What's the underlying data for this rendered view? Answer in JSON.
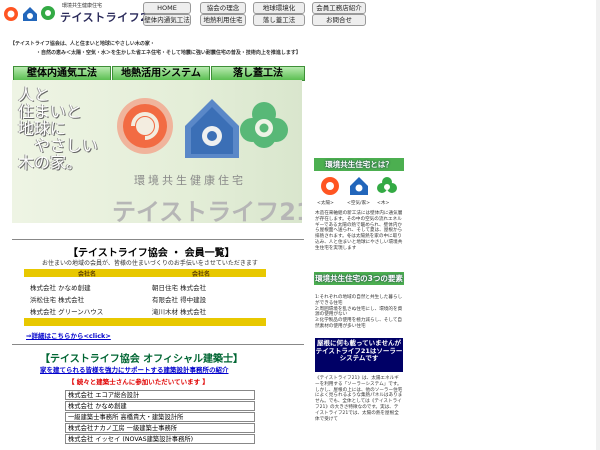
{
  "header": {
    "logo_subtitle": "環境共生健康住宅",
    "logo_title": "テイストライフ21"
  },
  "nav": {
    "row1": [
      "HOME",
      "協会の理念",
      "地球環境化",
      "会員工務店紹介"
    ],
    "row2": [
      "壁体内通気工法",
      "地熱利用住宅",
      "落し蓋工法",
      "お問合せ"
    ]
  },
  "intro": {
    "line1": "【テイストライフ協会は、人と住まいと地球にやさしい木の家・",
    "line2": "・自然の恵み＜太陽・空気・水＞を生かした省エネ住宅・そして地震に強い耐震住宅の普及・技術向上を推進します】"
  },
  "tabs": [
    "壁体内通気工法",
    "地熱活用システム",
    "落し蓋工法"
  ],
  "hero": {
    "lines": [
      "人と",
      "住まいと",
      "地球に",
      "やさしい",
      "木の家。"
    ],
    "subtitle": "環境共生健康住宅",
    "big": "テイストライフ21"
  },
  "members": {
    "title": "【テイストライフ協会 ・ 会員一覧】",
    "note": "お住まいの地域の会員が、皆様の住まいづくりのお手伝いをさせていただきます",
    "header": [
      "会社名",
      "会社名"
    ],
    "rows": [
      [
        "株式会社 かなめ創建",
        "朝日住宅 株式会社"
      ],
      [
        "浜松住宅 株式会社",
        "有限会社 得中建設"
      ],
      [
        "株式会社 グリーンハウス",
        "滝川木材 株式会社"
      ]
    ],
    "more_link": "⇒詳細はこちらから<click>"
  },
  "architects": {
    "title": "【テイストライフ協会 オフィシャル建築士】",
    "subtitle": "家を建てられる皆様を強力にサポートする建築設計事務所の紹介",
    "recruit": "【 続々と建築士さんに参加いただいています 】",
    "rows": [
      "株式会社 エコア総合設計",
      "株式会社 かなめ創建",
      "一級建築士事務所 高橋貴大・建築設計所",
      "株式会社ナカノ工房 一級建築士事務所",
      "株式会社 イッセイ (NOVAS建築設計事務所)"
    ]
  },
  "sidebar": {
    "heading1": "環境共生住宅とは？",
    "icon_labels": [
      "<太陽>",
      "<空気/家>",
      "<木>"
    ],
    "text1": "木造在来軸組の新工法には壁体内に通気層が存在します。その中の空気の流れエネルギーである太陽の熱で暖められ、壁体内から屋根面へ送られ、そして夏は、屋根から排熱されます。冬は太陽熱を家の中に取り込み、人と住まいと地球にやさしい環境共生住宅を実現します",
    "heading2": "環境共生住宅の3つの要素",
    "text2": "1:それぞれの地域の自然と共生した暮らしができる住宅\n2:周囲環境を乱さぬ住宅にし、環境的を資源の使用がない\n3:化学製品の使用を極力減らし、そして自然素材の使用が多い住宅",
    "blue_box": "屋根に何も載っていませんがテイストライフ21はソーラーシステムです",
    "text3": "《テイストライフ21》は、太陽エネルギーを利用する「ソーラーシステム」です。しかし、屋根の上には、他のソーラー住宅によく見られるような集熱パネルはありません。でも、全体としては《テイストライフ21》の大きさ特徴なのです。実は、テイストライフ21では、太陽の熱を屋根全体で受けて"
  }
}
